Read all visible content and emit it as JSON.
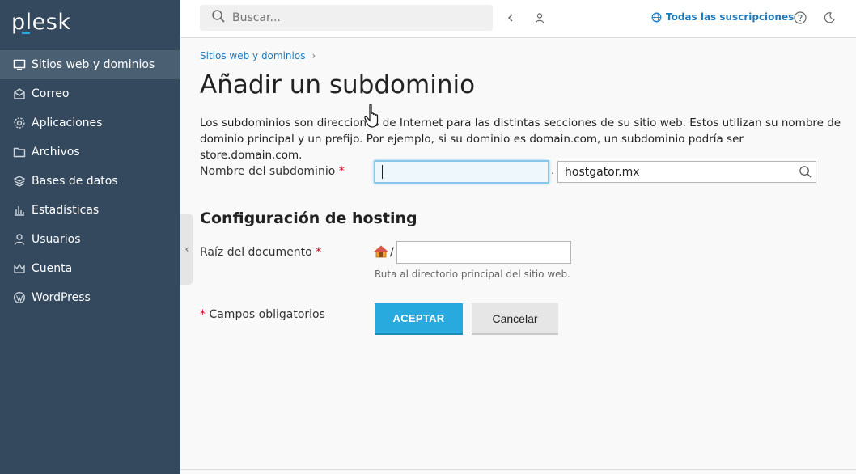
{
  "brand": {
    "logo_text": "plesk",
    "accent": "#28aade"
  },
  "sidebar": {
    "items": [
      {
        "label": "Sitios web y dominios",
        "icon": "monitor-icon",
        "active": true
      },
      {
        "label": "Correo",
        "icon": "mail-icon"
      },
      {
        "label": "Aplicaciones",
        "icon": "gear-icon"
      },
      {
        "label": "Archivos",
        "icon": "folder-icon"
      },
      {
        "label": "Bases de datos",
        "icon": "database-icon"
      },
      {
        "label": "Estadísticas",
        "icon": "bar-chart-icon"
      },
      {
        "label": "Usuarios",
        "icon": "user-icon"
      },
      {
        "label": "Cuenta",
        "icon": "crown-icon"
      },
      {
        "label": "WordPress",
        "icon": "wordpress-icon"
      }
    ]
  },
  "topbar": {
    "search_placeholder": "Buscar...",
    "subscriptions_label": "Todas las suscripciones"
  },
  "breadcrumb": {
    "item": "Sitios web y dominios"
  },
  "page": {
    "title": "Añadir un subdominio",
    "description": "Los subdominios son direcciones de Internet para las distintas secciones de su sitio web. Estos utilizan su nombre de dominio principal y un prefijo. Por ejemplo, si su dominio es domain.com, un subdominio podría ser store.domain.com."
  },
  "form": {
    "subdomain_label": "Nombre del subdominio",
    "subdomain_value": "",
    "required_mark": "*",
    "separator": ".",
    "domain_value": "hostgator.mx",
    "hosting_section_title": "Configuración de hosting",
    "docroot_label": "Raíz del documento",
    "docroot_prefix": "/",
    "docroot_value": "",
    "docroot_hint": "Ruta al directorio principal del sitio web.",
    "required_note": "Campos obligatorios",
    "ok_label": "ACEPTAR",
    "cancel_label": "Cancelar"
  }
}
